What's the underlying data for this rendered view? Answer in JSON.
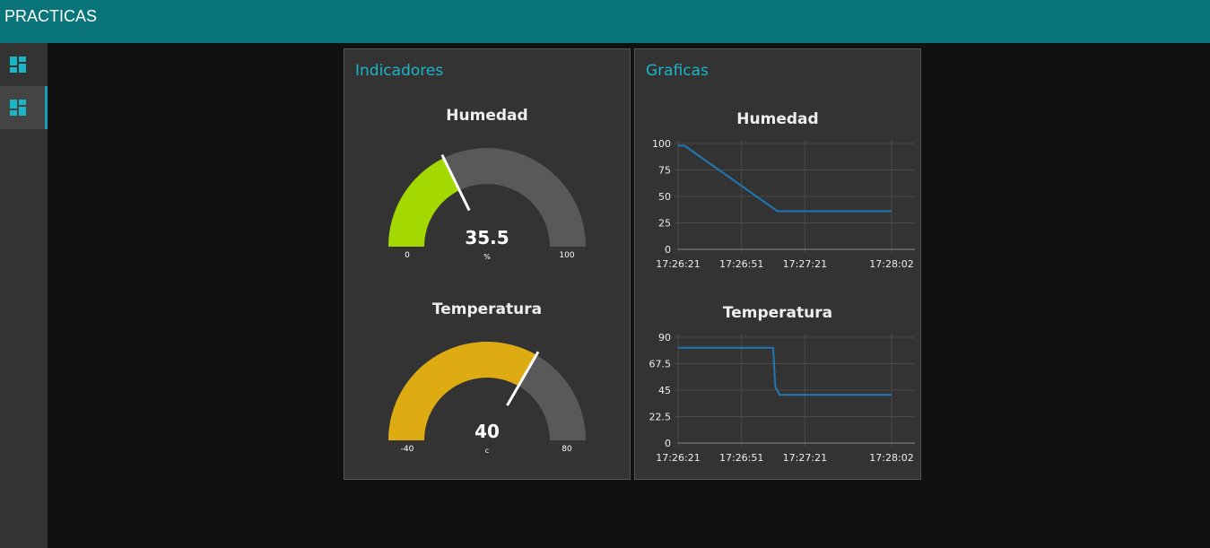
{
  "app": {
    "title": "PRACTICAS"
  },
  "sidebar": {
    "items": [
      {
        "icon": "dashboard-icon",
        "active": false
      },
      {
        "icon": "dashboard-icon",
        "active": true
      }
    ]
  },
  "indicadores": {
    "title": "Indicadores",
    "gauges": [
      {
        "title": "Humedad",
        "value": "35.5",
        "units": "%",
        "min": "0",
        "max": "100",
        "value_num": 35.5,
        "min_num": 0,
        "max_num": 100,
        "color": "#a3d900"
      },
      {
        "title": "Temperatura",
        "value": "40",
        "units": "c",
        "min": "-40",
        "max": "80",
        "value_num": 40,
        "min_num": -40,
        "max_num": 80,
        "color": "#dfab13"
      }
    ]
  },
  "graficas": {
    "title": "Graficas",
    "charts": [
      {
        "title": "Humedad"
      },
      {
        "title": "Temperatura"
      }
    ]
  },
  "chart_data": [
    {
      "type": "line",
      "title": "Humedad",
      "x": [
        "17:26:21",
        "17:26:24",
        "17:27:08",
        "17:28:02"
      ],
      "values": [
        98,
        98,
        36,
        36
      ],
      "ylim": [
        0,
        100
      ],
      "yticks": [
        "0",
        "25",
        "50",
        "75",
        "100"
      ],
      "xticks": [
        "17:26:21",
        "17:26:51",
        "17:27:21",
        "17:28:02"
      ],
      "grid": true,
      "color": "#1f77b4"
    },
    {
      "type": "line",
      "title": "Temperatura",
      "x": [
        "17:26:21",
        "17:27:06",
        "17:27:07",
        "17:27:09",
        "17:28:02"
      ],
      "values": [
        81,
        81,
        48,
        41,
        41
      ],
      "ylim": [
        0,
        90
      ],
      "yticks": [
        "0",
        "22.5",
        "45",
        "67.5",
        "90"
      ],
      "xticks": [
        "17:26:21",
        "17:26:51",
        "17:27:21",
        "17:28:02"
      ],
      "grid": true,
      "color": "#1f77b4"
    }
  ]
}
